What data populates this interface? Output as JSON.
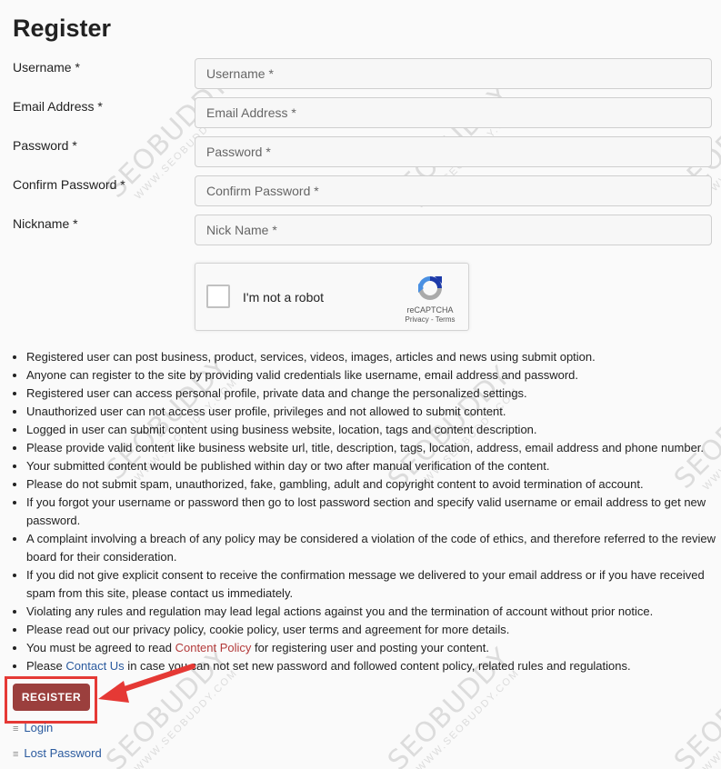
{
  "page": {
    "title": "Register"
  },
  "form": {
    "fields": [
      {
        "label": "Username *",
        "placeholder": "Username *",
        "value": ""
      },
      {
        "label": "Email Address *",
        "placeholder": "Email Address *",
        "value": ""
      },
      {
        "label": "Password *",
        "placeholder": "Password *",
        "value": ""
      },
      {
        "label": "Confirm Password *",
        "placeholder": "Confirm Password *",
        "value": ""
      },
      {
        "label": "Nickname *",
        "placeholder": "Nick Name *",
        "value": ""
      }
    ]
  },
  "recaptcha": {
    "label": "I'm not a robot",
    "brand": "reCAPTCHA",
    "privacy": "Privacy",
    "separator": " - ",
    "terms": "Terms",
    "colors": {
      "blue": "#1c3aa9",
      "lightblue": "#4a90e2",
      "gray": "#aaaaaa"
    }
  },
  "info_list": [
    "Registered user can post business, product, services, videos, images, articles and news using submit option.",
    "Anyone can register to the site by providing valid credentials like username, email address and password.",
    "Registered user can access personal profile, private data and change the personalized settings.",
    "Unauthorized user can not access user profile, privileges and not allowed to submit content.",
    "Logged in user can submit content using business website, location, tags and content description.",
    "Please provide valid content like business website url, title, description, tags, location, address, email address and phone number.",
    "Your submitted content would be published within day or two after manual verification of the content.",
    "Please do not submit spam, unauthorized, fake, gambling, adult and copyright content to avoid termination of account.",
    "If you forgot your username or password then go to lost password section and specify valid username or email address to get new password.",
    "A complaint involving a breach of any policy may be considered a violation of the code of ethics, and therefore referred to the review board for their consideration.",
    "If you did not give explicit consent to receive the confirmation message we delivered to your email address or if you have received spam from this site, please contact us immediately.",
    "Violating any rules and regulation may lead legal actions against you and the termination of account without prior notice.",
    "Please read out our privacy policy, cookie policy, user terms and agreement for more details."
  ],
  "policy_item": {
    "before": "You must be agreed to read ",
    "link": "Content Policy",
    "after": " for registering user and posting your content."
  },
  "contact_item": {
    "before": "Please ",
    "link": "Contact Us",
    "after": " in case you can not set new password and followed content policy, related rules and regulations."
  },
  "actions": {
    "register_label": "REGISTER",
    "login_label": "Login",
    "lost_password_label": "Lost Password",
    "bullet": "≡"
  },
  "watermark": {
    "text": "SEOBUDDY",
    "subtext": "WWW.SEOBUDDY.COM"
  },
  "colors": {
    "accent": "#9b3f3d",
    "highlight": "#e53935",
    "link": "#2a5a9e"
  }
}
